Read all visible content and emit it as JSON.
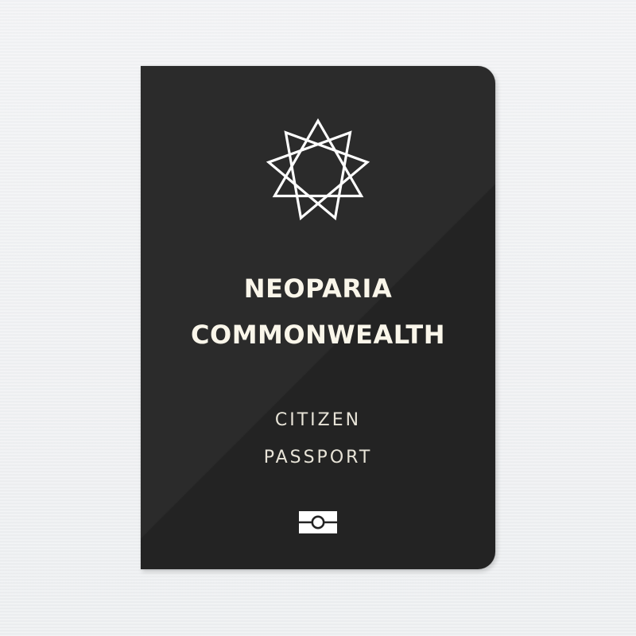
{
  "passport": {
    "country_line1": "NEOPARIA",
    "country_line2": "COMMONWEALTH",
    "doc_line1": "CITIZEN",
    "doc_line2": "PASSPORT",
    "emblem_icon": "nine-point-star-icon",
    "chip_icon": "biometric-chip-icon",
    "colors": {
      "cover": "#232323",
      "text": "#faf6ea",
      "background": "#eeeff1"
    }
  }
}
